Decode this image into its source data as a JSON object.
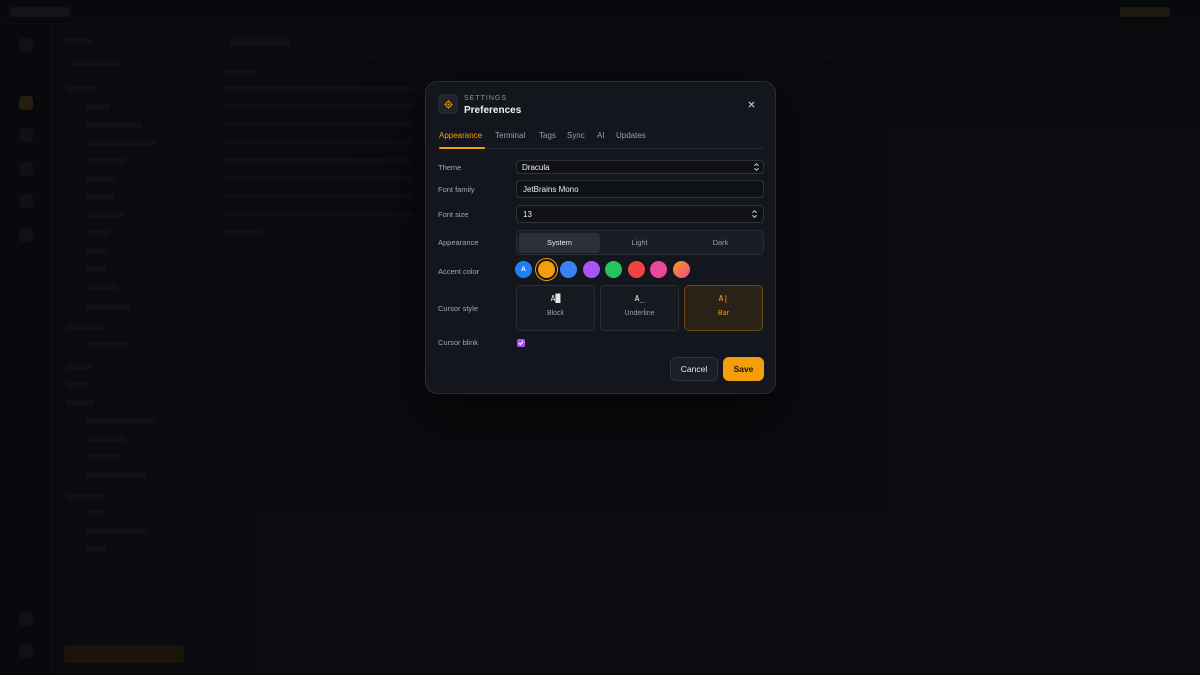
{
  "dialog": {
    "eyebrow": "SETTINGS",
    "title": "Preferences",
    "close_icon": "close-icon",
    "header_icon": "gear-icon"
  },
  "tabs": [
    {
      "label": "Appearance",
      "active": true
    },
    {
      "label": "Terminal",
      "active": false
    },
    {
      "label": "Tags",
      "active": false
    },
    {
      "label": "Sync",
      "active": false
    },
    {
      "label": "AI",
      "active": false
    },
    {
      "label": "Updates",
      "active": false
    }
  ],
  "form": {
    "theme": {
      "label": "Theme",
      "value": "Dracula"
    },
    "font_family": {
      "label": "Font family",
      "value": "JetBrains Mono"
    },
    "font_size": {
      "label": "Font size",
      "value": "13"
    },
    "appearance": {
      "label": "Appearance",
      "options": [
        "System",
        "Light",
        "Dark"
      ],
      "selected": "System"
    },
    "accent": {
      "label": "Accent color",
      "auto_label": "A",
      "swatches": [
        "#1d80f5",
        "#f59e0b",
        "#3b82f6",
        "#a855f7",
        "#22c55e",
        "#ef4444",
        "#ec4899",
        "gradient"
      ],
      "selected": "#f59e0b"
    },
    "cursor_style": {
      "label": "Cursor style",
      "options": [
        {
          "preview": "A█",
          "name": "Block"
        },
        {
          "preview": "A_",
          "name": "Underline"
        },
        {
          "preview": "A|",
          "name": "Bar"
        }
      ],
      "selected": "Bar"
    },
    "cursor_blink": {
      "label": "Cursor blink",
      "checked": true
    }
  },
  "actions": {
    "cancel": "Cancel",
    "save": "Save"
  },
  "colors": {
    "accent": "#f59e0b",
    "dialog_bg": "#14161d",
    "check": "#a855f7"
  }
}
